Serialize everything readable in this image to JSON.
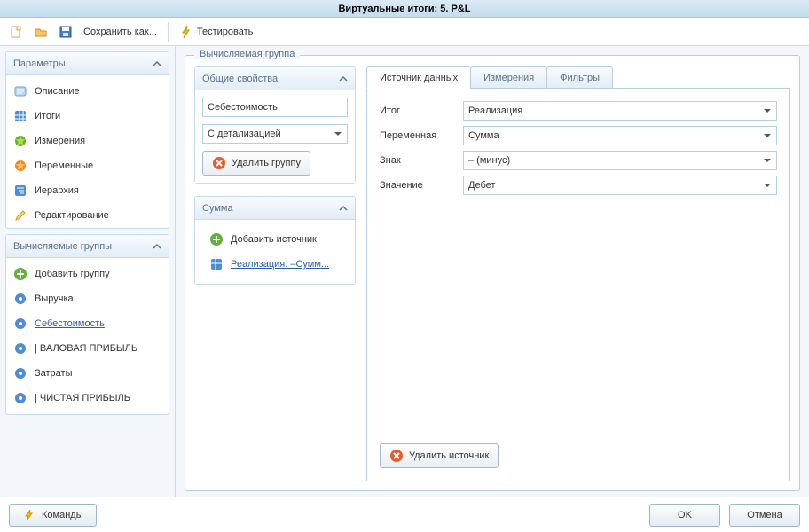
{
  "title": "Виртуальные итоги: 5. P&L",
  "toolbar": {
    "save_as": "Сохранить как...",
    "test": "Тестировать"
  },
  "sidebar": {
    "params": {
      "header": "Параметры",
      "items": [
        {
          "label": "Описание"
        },
        {
          "label": "Итоги"
        },
        {
          "label": "Измерения"
        },
        {
          "label": "Переменные"
        },
        {
          "label": "Иерархия"
        },
        {
          "label": "Редактирование"
        }
      ]
    },
    "groups": {
      "header": "Вычисляемые группы",
      "add_label": "Добавить группу",
      "items": [
        {
          "label": "Выручка"
        },
        {
          "label": "Себестоимость",
          "selected": true
        },
        {
          "label": "|   ВАЛОВАЯ ПРИБЫЛЬ"
        },
        {
          "label": "Затраты"
        },
        {
          "label": "|   ЧИСТАЯ ПРИБЫЛЬ"
        }
      ]
    }
  },
  "groupbox": {
    "title": "Вычисляемая группа",
    "common": {
      "header": "Общие свойства",
      "name_value": "Себестоимость",
      "detail_value": "С детализацией",
      "delete_label": "Удалить группу"
    },
    "sum": {
      "header": "Сумма",
      "add_label": "Добавить источник",
      "item_label": "Реализация: –Сумм..."
    },
    "tabs": {
      "t0": "Источник данных",
      "t1": "Измерения",
      "t2": "Фильтры",
      "fields": {
        "total_label": "Итог",
        "total_value": "Реализация",
        "var_label": "Переменная",
        "var_value": "Сумма",
        "sign_label": "Знак",
        "sign_value": "– (минус)",
        "value_label": "Значение",
        "value_value": "Дебет"
      },
      "delete_source": "Удалить источник"
    }
  },
  "bottom": {
    "commands": "Команды",
    "ok": "OK",
    "cancel": "Отмена"
  }
}
